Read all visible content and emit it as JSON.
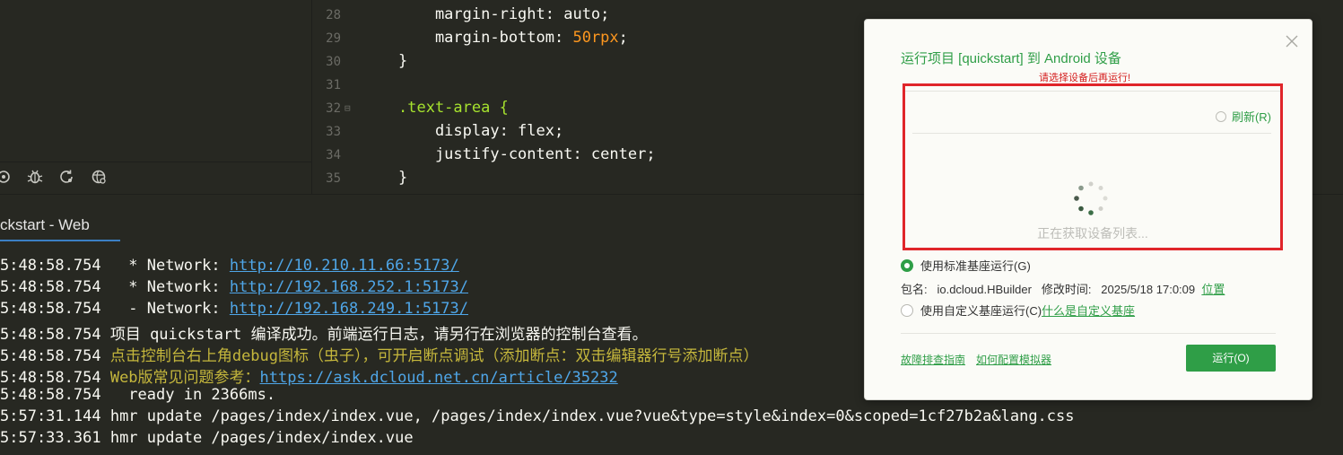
{
  "editor": {
    "lines": [
      {
        "num": "28",
        "text": "    margin-right: auto;"
      },
      {
        "num": "29",
        "text_pre": "    margin-bottom: ",
        "text_num": "50rpx",
        "text_post": ";"
      },
      {
        "num": "30",
        "text": "}"
      },
      {
        "num": "31",
        "text": ""
      },
      {
        "num": "32",
        "text": ".text-area {"
      },
      {
        "num": "33",
        "text": "    display: flex;"
      },
      {
        "num": "34",
        "text": "    justify-content: center;"
      },
      {
        "num": "35",
        "text": "}"
      }
    ]
  },
  "toolbar": {
    "icons": [
      "run-icon",
      "debug-icon",
      "refresh-run-icon",
      "browser-icon"
    ]
  },
  "console": {
    "tab_label": "ckstart - Web",
    "lines": [
      {
        "time": "5:48:58.754",
        "pre": "   * Network: ",
        "link": "http://10.210.11.66:5173/"
      },
      {
        "time": "5:48:58.754",
        "pre": "   * Network: ",
        "link": "http://192.168.252.1:5173/"
      },
      {
        "time": "5:48:58.754",
        "pre": "   - Network: ",
        "link": "http://192.168.249.1:5173/"
      },
      {
        "time": "5:48:58.754",
        "text": " 项目 quickstart 编译成功。前端运行日志，请另行在浏览器的控制台查看。"
      },
      {
        "time": "5:48:58.754",
        "yellow": " 点击控制台右上角debug图标（虫子），可开启断点调试（添加断点：双击编辑器行号添加断点）"
      },
      {
        "time": "5:48:58.754",
        "yellow": " Web版常见问题参考：",
        "link": "https://ask.dcloud.net.cn/article/35232"
      },
      {
        "time": "5:48:58.754",
        "text": "   ready in 2366ms."
      },
      {
        "time": "5:57:31.144",
        "text": " hmr update /pages/index/index.vue, /pages/index/index.vue?vue&type=style&index=0&scoped=1cf27b2a&lang.css"
      },
      {
        "time": "5:57:33.361",
        "text": " hmr update /pages/index/index.vue"
      }
    ]
  },
  "dialog": {
    "title": "运行项目 [quickstart] 到 Android 设备",
    "warning": "请选择设备后再运行!",
    "refresh_label": "刷新(R)",
    "loading_text": "正在获取设备列表...",
    "option_standard": "使用标准基座运行(G)",
    "pkg_label": "包名:",
    "pkg_value": "io.dcloud.HBuilder",
    "modified_label": "修改时间:",
    "modified_value": "2025/5/18 17:0:09",
    "location_link": "位置",
    "option_custom": "使用自定义基座运行(C)",
    "custom_help_link": "什么是自定义基座",
    "troubleshoot_link": "故障排查指南",
    "emulator_link": "如何配置模拟器",
    "run_button": "运行(O)",
    "colors": {
      "accent": "#2f9e47",
      "warning": "#d41c1c",
      "highlight_border": "#e0252a"
    }
  }
}
